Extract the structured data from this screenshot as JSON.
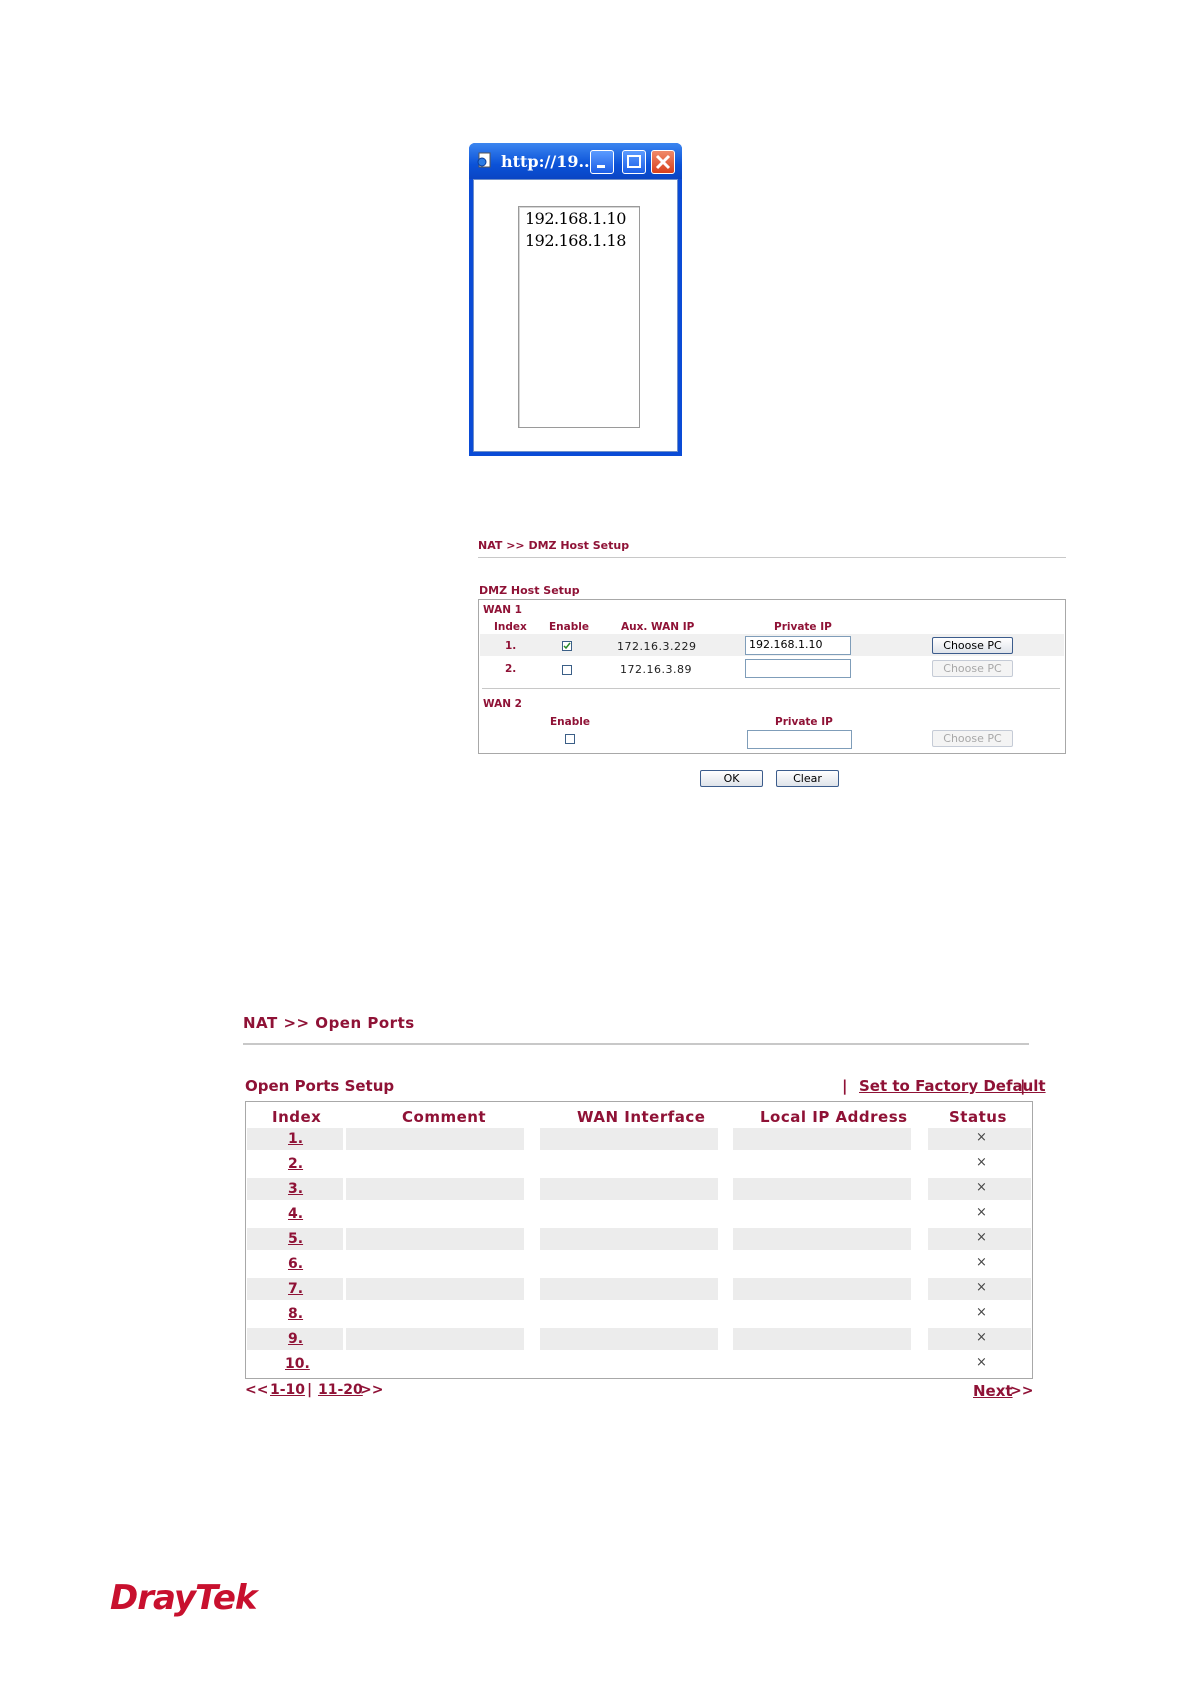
{
  "popup": {
    "title": "http://19...",
    "ip_list": [
      "192.168.1.10",
      "192.168.1.18"
    ]
  },
  "dmz": {
    "breadcrumb": "NAT >> DMZ Host Setup",
    "section_title": "DMZ Host Setup",
    "wan1_label": "WAN 1",
    "headers": {
      "index": "Index",
      "enable": "Enable",
      "aux_wan_ip": "Aux. WAN IP",
      "private_ip": "Private IP"
    },
    "rows": [
      {
        "index": "1.",
        "enabled": true,
        "aux_wan_ip": "172.16.3.229",
        "private_ip": "192.168.1.10",
        "choose_pc": "Choose PC",
        "choose_pc_enabled": true
      },
      {
        "index": "2.",
        "enabled": false,
        "aux_wan_ip": "172.16.3.89",
        "private_ip": "",
        "choose_pc": "Choose PC",
        "choose_pc_enabled": false
      }
    ],
    "wan2": {
      "label": "WAN 2",
      "enable_header": "Enable",
      "private_ip_header": "Private IP",
      "enabled": false,
      "private_ip": "",
      "choose_pc": "Choose PC"
    },
    "ok_label": "OK",
    "clear_label": "Clear"
  },
  "open_ports": {
    "breadcrumb": "NAT >> Open Ports",
    "section_title": "Open Ports Setup",
    "factory_default": "Set to Factory Default",
    "separator": "|",
    "headers": {
      "index": "Index",
      "comment": "Comment",
      "wan_interface": "WAN Interface",
      "local_ip": "Local IP Address",
      "status": "Status"
    },
    "rows": [
      {
        "index": "1.",
        "status": "×"
      },
      {
        "index": "2.",
        "status": "×"
      },
      {
        "index": "3.",
        "status": "×"
      },
      {
        "index": "4.",
        "status": "×"
      },
      {
        "index": "5.",
        "status": "×"
      },
      {
        "index": "6.",
        "status": "×"
      },
      {
        "index": "7.",
        "status": "×"
      },
      {
        "index": "8.",
        "status": "×"
      },
      {
        "index": "9.",
        "status": "×"
      },
      {
        "index": "10.",
        "status": "×"
      }
    ],
    "pager": {
      "prev": "<<",
      "range1": "1-10",
      "sep": "|",
      "range2": "11-20",
      "next_arrows": ">>",
      "next": "Next"
    }
  },
  "brand": {
    "logo_text": "DrayTek",
    "color": "#c8102e"
  }
}
